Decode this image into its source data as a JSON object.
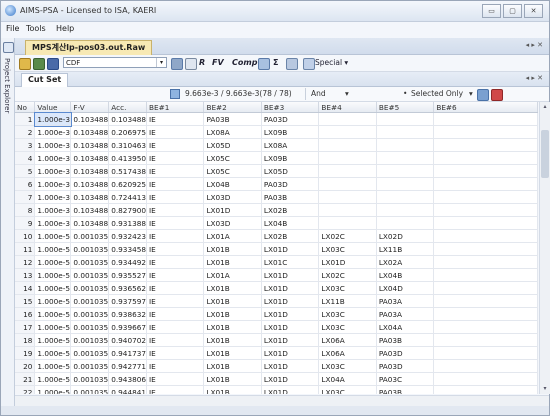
{
  "window": {
    "title": "AIMS-PSA - Licensed to ISA, KAERI",
    "btn_min": "▭",
    "btn_max": "▢",
    "btn_close": "✕"
  },
  "menu": [
    "File",
    "Tools",
    "Help"
  ],
  "sidebar": {
    "label": "Project Explorer",
    "icon": "project-explorer-icon"
  },
  "doc_tab": {
    "label": "MPS계산lp-pos03.out.Raw",
    "nav": "◂ ▸ ✕"
  },
  "toolbar": {
    "combo_value": "CDF",
    "special_label": "Special ▾",
    "fv_label": "FV",
    "comp_label": "Comp",
    "sigma": "Σ",
    "r_label": "R"
  },
  "cut_tab": {
    "label": "Cut Set",
    "nav": "◂ ▸ ✕"
  },
  "filter": {
    "value_text": "9.663e-3 / 9.663e-3(78 / 78)",
    "op": "And",
    "op_arrow": "▾",
    "mode": "Selected Only",
    "mode_arrow": "▾"
  },
  "table": {
    "columns": [
      "No",
      "Value",
      "F-V",
      "Acc.",
      "BE#1",
      "BE#2",
      "BE#3",
      "BE#4",
      "BE#5",
      "BE#6"
    ],
    "rows": [
      [
        "1",
        "1.000e-3",
        "0.103488",
        "0.103488",
        "IE",
        "PA03B",
        "PA03D",
        "",
        "",
        ""
      ],
      [
        "2",
        "1.000e-3",
        "0.103488",
        "0.206975",
        "IE",
        "LX08A",
        "LX09B",
        "",
        "",
        ""
      ],
      [
        "3",
        "1.000e-3",
        "0.103488",
        "0.310463",
        "IE",
        "LX05D",
        "LX08A",
        "",
        "",
        ""
      ],
      [
        "4",
        "1.000e-3",
        "0.103488",
        "0.413950",
        "IE",
        "LX05C",
        "LX09B",
        "",
        "",
        ""
      ],
      [
        "5",
        "1.000e-3",
        "0.103488",
        "0.517438",
        "IE",
        "LX05C",
        "LX05D",
        "",
        "",
        ""
      ],
      [
        "6",
        "1.000e-3",
        "0.103488",
        "0.620925",
        "IE",
        "LX04B",
        "PA03D",
        "",
        "",
        ""
      ],
      [
        "7",
        "1.000e-3",
        "0.103488",
        "0.724413",
        "IE",
        "LX03D",
        "PA03B",
        "",
        "",
        ""
      ],
      [
        "8",
        "1.000e-3",
        "0.103488",
        "0.827900",
        "IE",
        "LX01D",
        "LX02B",
        "",
        "",
        ""
      ],
      [
        "9",
        "1.000e-3",
        "0.103488",
        "0.931388",
        "IE",
        "LX03D",
        "LX04B",
        "",
        "",
        ""
      ],
      [
        "10",
        "1.000e-5",
        "0.001035",
        "0.932423",
        "IE",
        "LX01A",
        "LX02B",
        "LX02C",
        "LX02D",
        ""
      ],
      [
        "11",
        "1.000e-5",
        "0.001035",
        "0.933458",
        "IE",
        "LX01B",
        "LX01D",
        "LX03C",
        "LX11B",
        ""
      ],
      [
        "12",
        "1.000e-5",
        "0.001035",
        "0.934492",
        "IE",
        "LX01B",
        "LX01C",
        "LX01D",
        "LX02A",
        ""
      ],
      [
        "13",
        "1.000e-5",
        "0.001035",
        "0.935527",
        "IE",
        "LX01A",
        "LX01D",
        "LX02C",
        "LX04B",
        ""
      ],
      [
        "14",
        "1.000e-5",
        "0.001035",
        "0.936562",
        "IE",
        "LX01B",
        "LX01D",
        "LX03C",
        "LX04D",
        ""
      ],
      [
        "15",
        "1.000e-5",
        "0.001035",
        "0.937597",
        "IE",
        "LX01B",
        "LX01D",
        "LX11B",
        "PA03A",
        ""
      ],
      [
        "16",
        "1.000e-5",
        "0.001035",
        "0.938632",
        "IE",
        "LX01B",
        "LX01D",
        "LX03C",
        "PA03A",
        ""
      ],
      [
        "17",
        "1.000e-5",
        "0.001035",
        "0.939667",
        "IE",
        "LX01B",
        "LX01D",
        "LX03C",
        "LX04A",
        ""
      ],
      [
        "18",
        "1.000e-5",
        "0.001035",
        "0.940702",
        "IE",
        "LX01B",
        "LX01D",
        "LX06A",
        "PA03B",
        ""
      ],
      [
        "19",
        "1.000e-5",
        "0.001035",
        "0.941737",
        "IE",
        "LX01B",
        "LX01D",
        "LX06A",
        "PA03D",
        ""
      ],
      [
        "20",
        "1.000e-5",
        "0.001035",
        "0.942771",
        "IE",
        "LX01B",
        "LX01D",
        "LX03C",
        "PA03D",
        ""
      ],
      [
        "21",
        "1.000e-5",
        "0.001035",
        "0.943806",
        "IE",
        "LX01B",
        "LX01D",
        "LX04A",
        "PA03C",
        ""
      ],
      [
        "22",
        "1.000e-5",
        "0.001035",
        "0.944841",
        "IE",
        "LX01B",
        "LX01D",
        "LX03C",
        "PA03B",
        ""
      ]
    ],
    "selected_cell": {
      "row": 1,
      "column": "Value"
    }
  },
  "scroll": {
    "up": "▴",
    "down": "▾"
  },
  "colors": {
    "tab_accent": "#f7e9b4",
    "selection": "#dbe8fb",
    "chrome": "#f3f6fb"
  }
}
